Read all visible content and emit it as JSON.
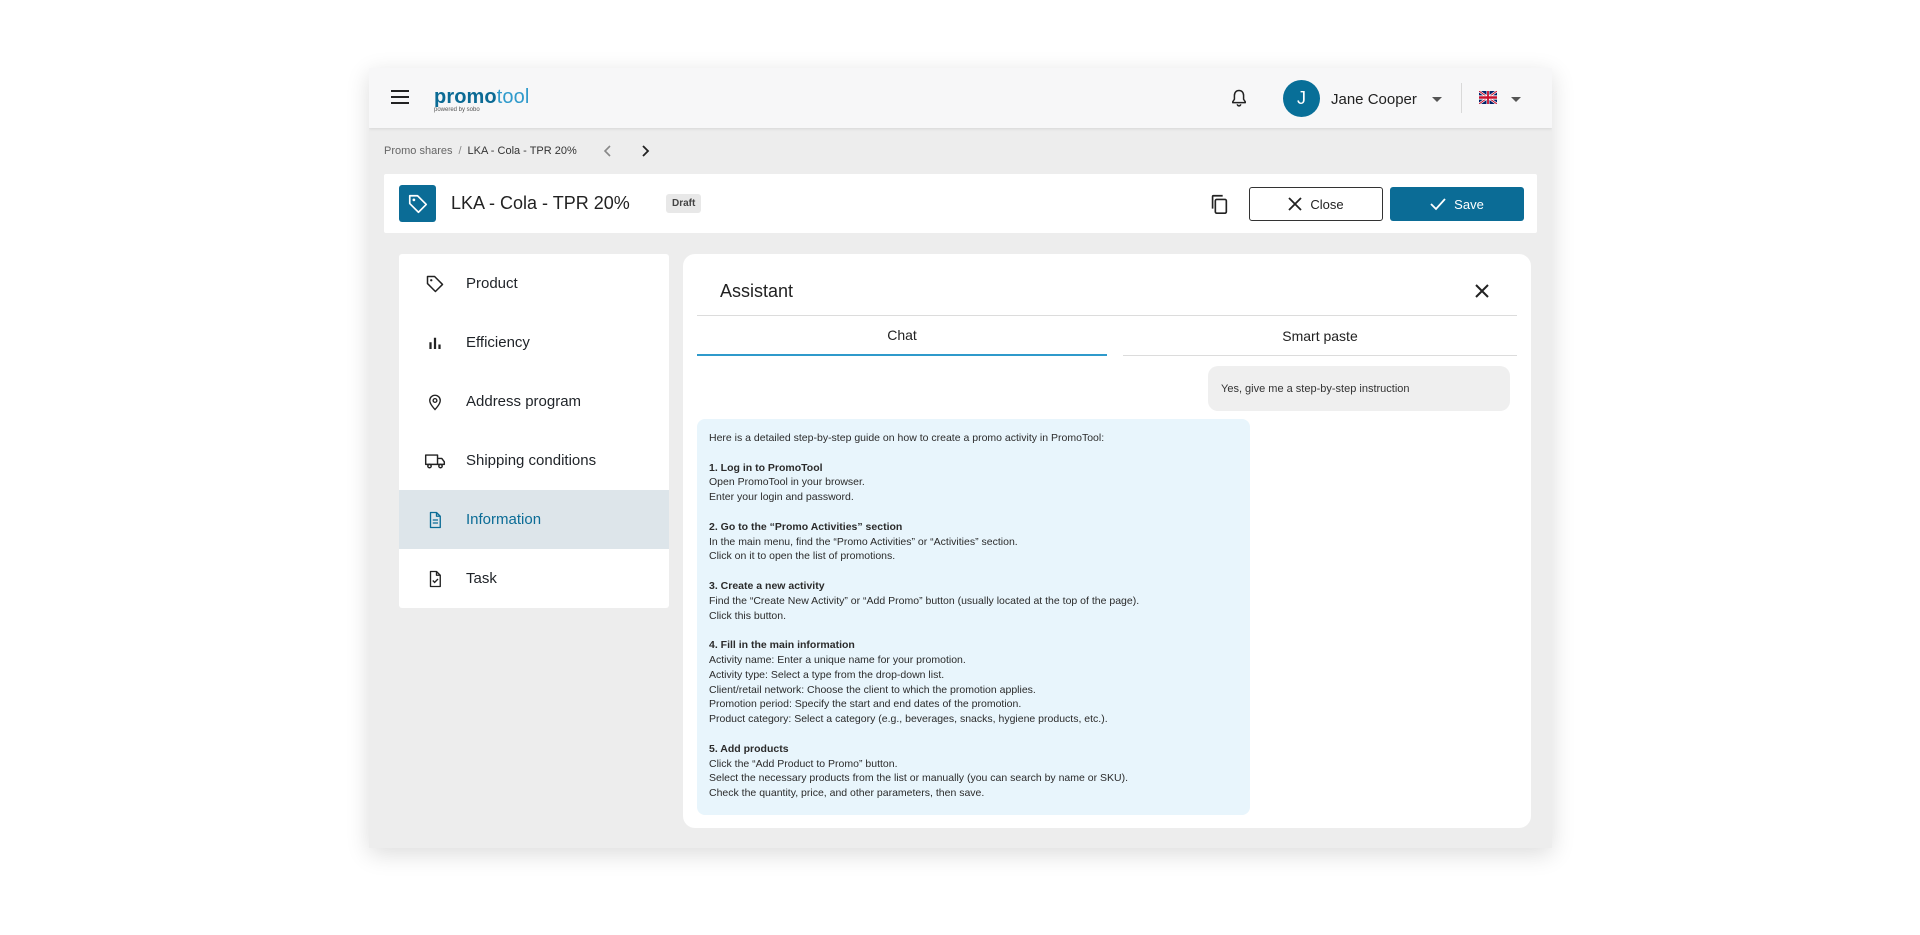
{
  "app": {
    "logo_main": "promo",
    "logo_accent": "tool",
    "logo_sub": "powered by sobo"
  },
  "user": {
    "initial": "J",
    "name": "Jane Cooper"
  },
  "breadcrumb": {
    "parent": "Promo shares",
    "separator": "/",
    "current": "LKA - Cola - TPR 20%"
  },
  "header": {
    "title": "LKA - Cola - TPR 20%",
    "status": "Draft",
    "close_label": "Close",
    "save_label": "Save"
  },
  "sidebar": {
    "items": [
      {
        "label": "Product",
        "icon": "tag-icon"
      },
      {
        "label": "Efficiency",
        "icon": "bar-chart-icon"
      },
      {
        "label": "Address program",
        "icon": "location-pin-icon"
      },
      {
        "label": "Shipping conditions",
        "icon": "truck-icon"
      },
      {
        "label": "Information",
        "icon": "document-icon",
        "active": true
      },
      {
        "label": "Task",
        "icon": "task-check-icon"
      }
    ]
  },
  "assistant": {
    "title": "Assistant",
    "tabs": [
      {
        "label": "Chat",
        "active": true
      },
      {
        "label": "Smart paste",
        "active": false
      }
    ],
    "user_message": "Yes, give me a step-by-step instruction",
    "bot_message": {
      "intro": "Here is a detailed step-by-step guide on how to create a promo activity in PromoTool:",
      "steps": [
        {
          "heading": "1. Log in to PromoTool",
          "lines": [
            "Open PromoTool in your browser.",
            "Enter your login and password."
          ]
        },
        {
          "heading": "2. Go to the “Promo Activities” section",
          "lines": [
            "In the main menu, find the “Promo Activities” or “Activities” section.",
            "Click on it to open the list of promotions."
          ]
        },
        {
          "heading": "3. Create a new activity",
          "lines": [
            "Find the “Create New Activity” or “Add Promo” button (usually located at the top of the page).",
            "Click this button."
          ]
        },
        {
          "heading": "4. Fill in the main information",
          "lines": [
            "Activity name: Enter a unique name for your promotion.",
            "Activity type: Select a type from the drop-down list.",
            "Client/retail network: Choose the client to which the promotion applies.",
            "Promotion period: Specify the start and end dates of the promotion.",
            "Product category: Select a category (e.g., beverages, snacks, hygiene products, etc.)."
          ]
        },
        {
          "heading": "5. Add products",
          "lines": [
            "Click the “Add Product to Promo” button.",
            "Select the necessary products from the list or manually (you can search by name or SKU).",
            "Check the quantity, price, and other parameters, then save."
          ]
        }
      ]
    }
  },
  "colors": {
    "primary": "#0b6c96",
    "accent": "#2f9acb",
    "active_bg": "#dde5ea",
    "bot_bubble": "#e8f5fc",
    "user_bubble": "#efefef"
  }
}
